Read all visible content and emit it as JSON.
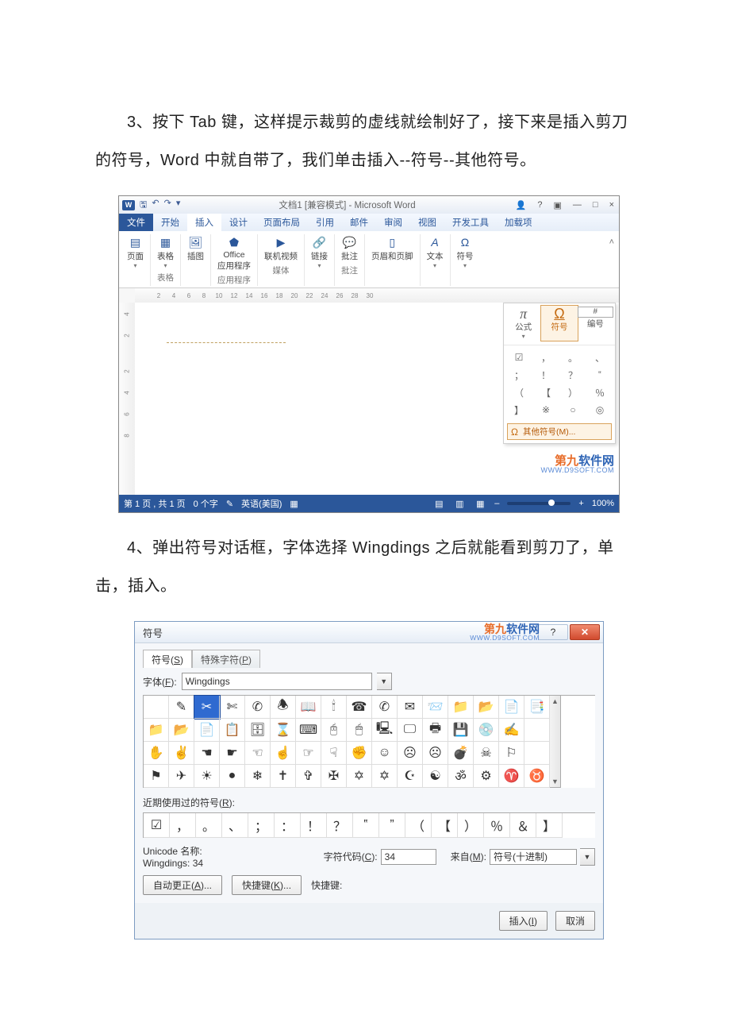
{
  "para1": "3、按下 Tab 键，这样提示裁剪的虚线就绘制好了，接下来是插入剪刀的符号，Word 中就自带了，我们单击插入--符号--其他符号。",
  "para2": "4、弹出符号对话框，字体选择 Wingdings 之后就能看到剪刀了，单击，插入。",
  "wordwin": {
    "title": "文档1 [兼容模式] - Microsoft Word",
    "logo": "W",
    "tabs": {
      "file": "文件",
      "home": "开始",
      "insert": "插入",
      "design": "设计",
      "layout": "页面布局",
      "ref": "引用",
      "mail": "邮件",
      "review": "审阅",
      "view": "视图",
      "dev": "开发工具",
      "addin": "加载项"
    },
    "ribbon": {
      "page": "页面",
      "table": "表格",
      "illus": "插图",
      "office": "Office\n应用程序",
      "officegrp": "应用程序",
      "video": "联机视频",
      "media": "媒体",
      "link": "链接",
      "comment": "批注",
      "headerfooter": "页眉和页脚",
      "text": "文本",
      "symbol": "符号"
    },
    "ruler_h": [
      "2",
      "4",
      "6",
      "8",
      "10",
      "12",
      "14",
      "16",
      "18",
      "20",
      "22",
      "24",
      "26",
      "28",
      "30"
    ],
    "ruler_v": [
      "4",
      "2",
      "",
      "2",
      "4",
      "6",
      "8"
    ],
    "popup": {
      "formula": "公式",
      "symbol": "符号",
      "number": "编号",
      "grid": [
        "☑",
        "，",
        "。",
        "、",
        "；",
        "！",
        "？",
        "‟",
        "（",
        "【",
        "）",
        "％",
        "】",
        "※",
        "○",
        "◎"
      ],
      "more": "其他符号(M)..."
    },
    "status": {
      "page": "第 1 页 , 共 1 页",
      "words": "0 个字",
      "lang": "英语(美国)",
      "zoom": "100%"
    },
    "watermark1": "第九",
    "watermark2": "软件网",
    "watermark_url": "WWW.D9SOFT.COM"
  },
  "symdlg": {
    "title": "符号",
    "tab_symbol": "符号(S)",
    "tab_special": "特殊字符(P)",
    "font_label": "字体(F):",
    "font_value": "Wingdings",
    "recent_label": "近期使用过的符号(R):",
    "unicode_label": "Unicode 名称:",
    "unicode_value": "Wingdings: 34",
    "code_label": "字符代码(C):",
    "code_value": "34",
    "from_label": "来自(M):",
    "from_value": "符号(十进制)",
    "btn_autocorrect": "自动更正(A)...",
    "btn_shortcut": "快捷键(K)...",
    "shortcut_label": "快捷键:",
    "btn_insert": "插入(I)",
    "btn_cancel": "取消",
    "grid": [
      [
        "",
        "✎",
        "✂",
        "✄",
        "✆",
        "🕭",
        "📖",
        "🕯",
        "☎",
        "✆",
        "✉",
        "📨",
        "📁",
        "📂",
        "📄",
        "📑"
      ],
      [
        "📁",
        "📂",
        "📄",
        "📋",
        "🗄",
        "⌛",
        "⌨",
        "🖰",
        "🖱",
        "🖳",
        "🖵",
        "🖶",
        "💾",
        "💿",
        "✍",
        ""
      ],
      [
        "✋",
        "✌",
        "☚",
        "☛",
        "☜",
        "☝",
        "☞",
        "☟",
        "✊",
        "☺",
        "☹",
        "☹",
        "💣",
        "☠",
        "⚐",
        ""
      ],
      [
        "⚑",
        "✈",
        "☀",
        "●",
        "❄",
        "✝",
        "✞",
        "✠",
        "✡",
        "✡",
        "☪",
        "☯",
        "ॐ",
        "⚙",
        "♈",
        "♉"
      ]
    ],
    "recent": [
      "☑",
      "，",
      "。",
      "、",
      "；",
      "：",
      "！",
      "？",
      "‟",
      "”",
      "（",
      "【",
      "）",
      "％",
      "＆",
      "】"
    ]
  }
}
